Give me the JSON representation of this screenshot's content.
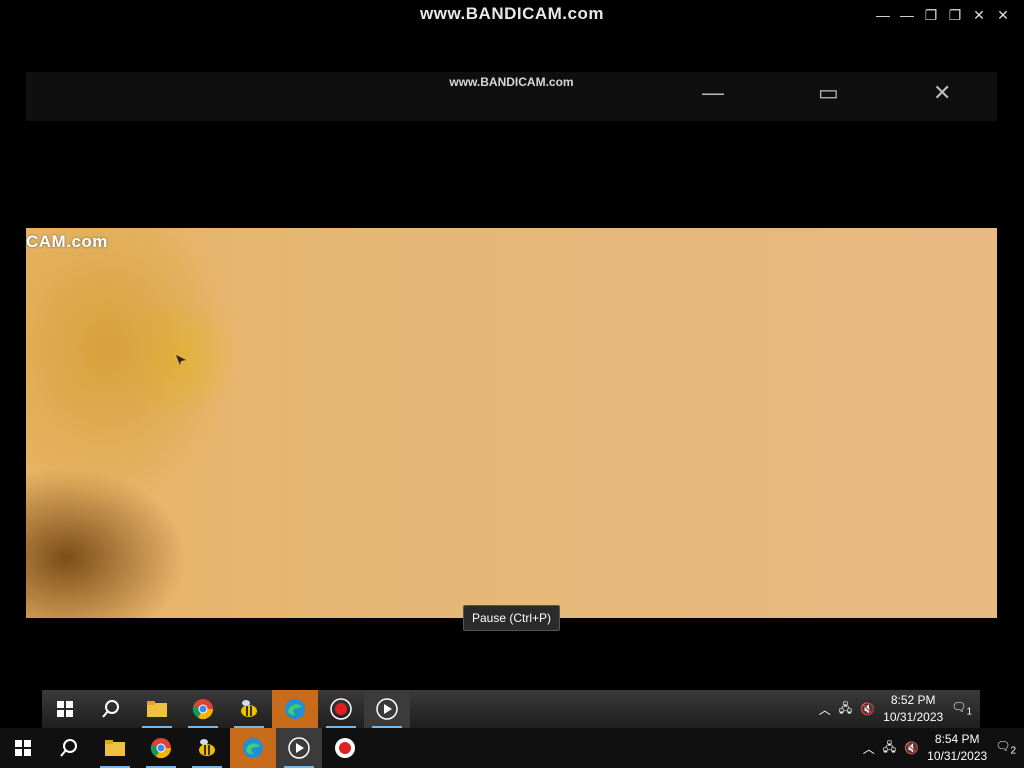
{
  "outer_window": {
    "watermark": "www.BANDICAM.com",
    "controls": [
      "minimize",
      "restore-small",
      "restore",
      "maximize",
      "close"
    ]
  },
  "inner_window": {
    "watermark": "www.BANDICAM.com",
    "controls": [
      "minimize",
      "maximize",
      "close"
    ]
  },
  "video": {
    "watermark": "CAM.com"
  },
  "tooltip": "Pause (Ctrl+P)",
  "taskbar_inner": {
    "apps": [
      "start-icon",
      "search-icon",
      "file-explorer-icon",
      "chrome-icon",
      "bee-app-icon",
      "edge-icon",
      "record-icon",
      "play-icon"
    ],
    "time": "8:52 PM",
    "date": "10/31/2023",
    "notification_count": "1"
  },
  "taskbar_outer": {
    "apps": [
      "start-icon",
      "search-icon",
      "file-explorer-icon",
      "chrome-icon",
      "bee-app-icon",
      "edge-icon",
      "play-icon",
      "record-icon"
    ],
    "time": "8:54 PM",
    "date": "10/31/2023",
    "notification_count": "2"
  },
  "colors": {
    "taskbar_active": "#c86b1a",
    "taskbar_underline": "#76b9ed",
    "video_bg": "#e8b983"
  }
}
